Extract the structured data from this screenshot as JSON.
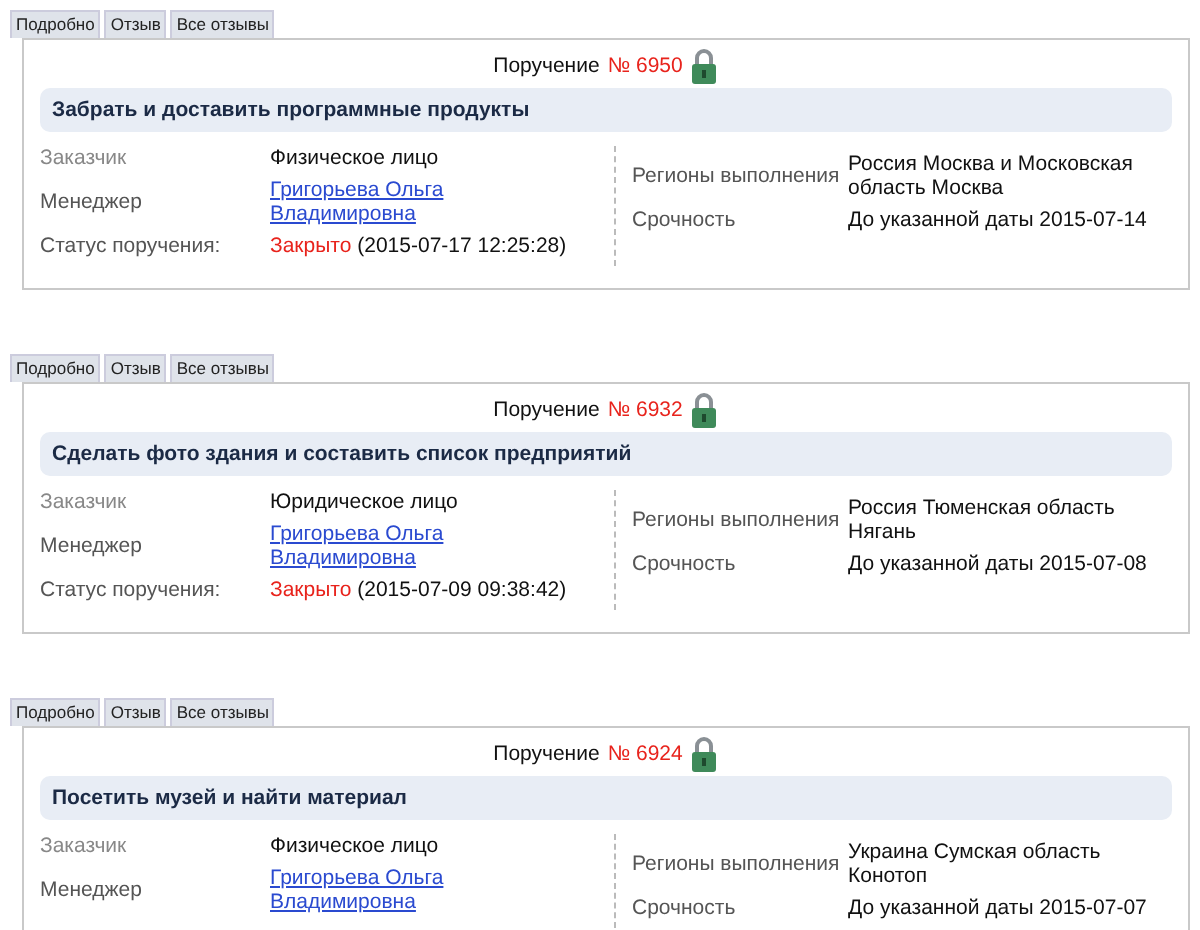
{
  "orders": [
    {
      "tabs": [
        "Подробно",
        "Отзыв",
        "Все отзывы"
      ],
      "order_label": "Поручение",
      "order_number": "№ 6950",
      "title": "Забрать и доставить программные продукты",
      "customer_label": "Заказчик",
      "customer": "Физическое лицо",
      "manager_label": "Менеджер",
      "manager": "Григорьева Ольга Владимировна",
      "status_label": "Статус поручения:",
      "status": "Закрыто",
      "status_time": "(2015-07-17 12:25:28)",
      "regions_label": "Регионы выполнения",
      "regions": "Россия Москва и Московская область Москва",
      "urgency_label": "Срочность",
      "urgency": "До указанной даты 2015-07-14"
    },
    {
      "tabs": [
        "Подробно",
        "Отзыв",
        "Все отзывы"
      ],
      "order_label": "Поручение",
      "order_number": "№ 6932",
      "title": "Сделать фото здания и составить список предприятий",
      "customer_label": "Заказчик",
      "customer": "Юридическое лицо",
      "manager_label": "Менеджер",
      "manager": "Григорьева Ольга Владимировна",
      "status_label": "Статус поручения:",
      "status": "Закрыто",
      "status_time": "(2015-07-09 09:38:42)",
      "regions_label": "Регионы выполнения",
      "regions": "Россия Тюменская область Нягань",
      "urgency_label": "Срочность",
      "urgency": "До указанной даты 2015-07-08"
    },
    {
      "tabs": [
        "Подробно",
        "Отзыв",
        "Все отзывы"
      ],
      "order_label": "Поручение",
      "order_number": "№ 6924",
      "title": "Посетить музей и найти материал",
      "customer_label": "Заказчик",
      "customer": "Физическое лицо",
      "manager_label": "Менеджер",
      "manager": "Григорьева Ольга Владимировна",
      "regions_label": "Регионы выполнения",
      "regions": "Украина Сумская область Конотоп",
      "urgency_label": "Срочность",
      "urgency": "До указанной даты 2015-07-07"
    }
  ]
}
